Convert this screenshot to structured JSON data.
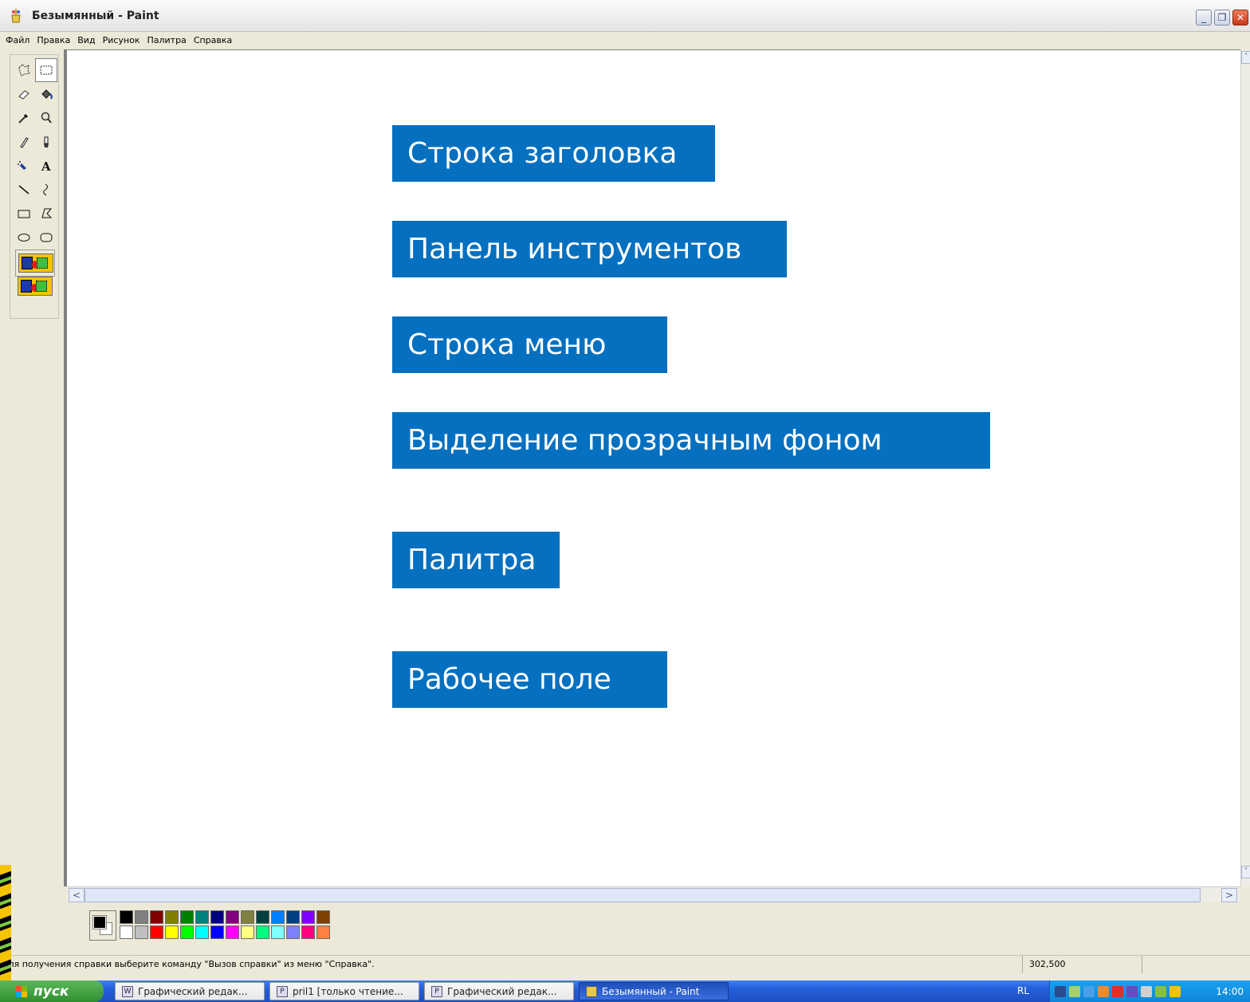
{
  "window": {
    "title": "Безымянный - Paint",
    "controls": {
      "minimize": "_",
      "restore": "❐",
      "close": "✕"
    }
  },
  "menubar": {
    "items": [
      {
        "label": "Файл"
      },
      {
        "label": "Правка"
      },
      {
        "label": "Вид"
      },
      {
        "label": "Рисунок"
      },
      {
        "label": "Палитра"
      },
      {
        "label": "Справка"
      }
    ]
  },
  "toolbox": {
    "tools": [
      "free-select-icon",
      "rect-select-icon",
      "eraser-icon",
      "fill-icon",
      "color-picker-icon",
      "magnifier-icon",
      "pencil-icon",
      "brush-icon",
      "airbrush-icon",
      "text-icon",
      "line-icon",
      "curve-icon",
      "rectangle-icon",
      "polygon-icon",
      "ellipse-icon",
      "rounded-rect-icon"
    ],
    "selected_tool": "rect-select-icon"
  },
  "canvas": {
    "labels": [
      {
        "text": "Строка заголовка"
      },
      {
        "text": "Панель инструментов"
      },
      {
        "text": "Строка меню"
      },
      {
        "text": "Выделение прозрачным фоном"
      },
      {
        "text": "Палитра"
      },
      {
        "text": "Рабочее поле"
      }
    ],
    "label_color": "#0470bf"
  },
  "palette": {
    "foreground": "#000000",
    "background": "#ffffff",
    "row1": [
      "#000000",
      "#808080",
      "#800000",
      "#808000",
      "#008000",
      "#008080",
      "#000080",
      "#800080",
      "#808040",
      "#004040",
      "#0080ff",
      "#004080",
      "#8000ff",
      "#804000"
    ],
    "row2": [
      "#ffffff",
      "#c0c0c0",
      "#ff0000",
      "#ffff00",
      "#00ff00",
      "#00ffff",
      "#0000ff",
      "#ff00ff",
      "#ffff80",
      "#00ff80",
      "#80ffff",
      "#8080ff",
      "#ff0080",
      "#ff8040"
    ]
  },
  "statusbar": {
    "help_text": "Для получения справки выберите команду \"Вызов справки\" из меню \"Справка\".",
    "coords": "302,500"
  },
  "taskbar": {
    "start_label": "пуск",
    "buttons": [
      {
        "label": "Графический редак..."
      },
      {
        "label": "pril1 [только чтение..."
      },
      {
        "label": "Графический редак..."
      },
      {
        "label": "Безымянный - Paint"
      }
    ],
    "language": "RL",
    "clock": "14:00"
  }
}
